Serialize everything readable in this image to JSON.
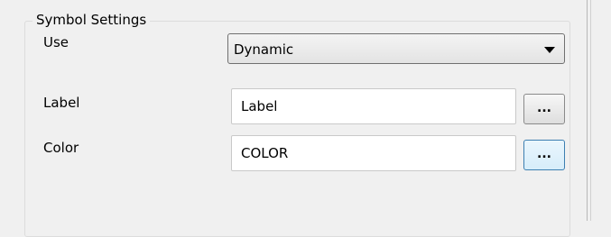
{
  "group": {
    "title": "Symbol Settings"
  },
  "use": {
    "label": "Use",
    "selected": "Dynamic"
  },
  "label_field": {
    "label": "Label",
    "value": "Label",
    "button_label": "..."
  },
  "color_field": {
    "label": "Color",
    "value": "COLOR",
    "button_label": "..."
  }
}
